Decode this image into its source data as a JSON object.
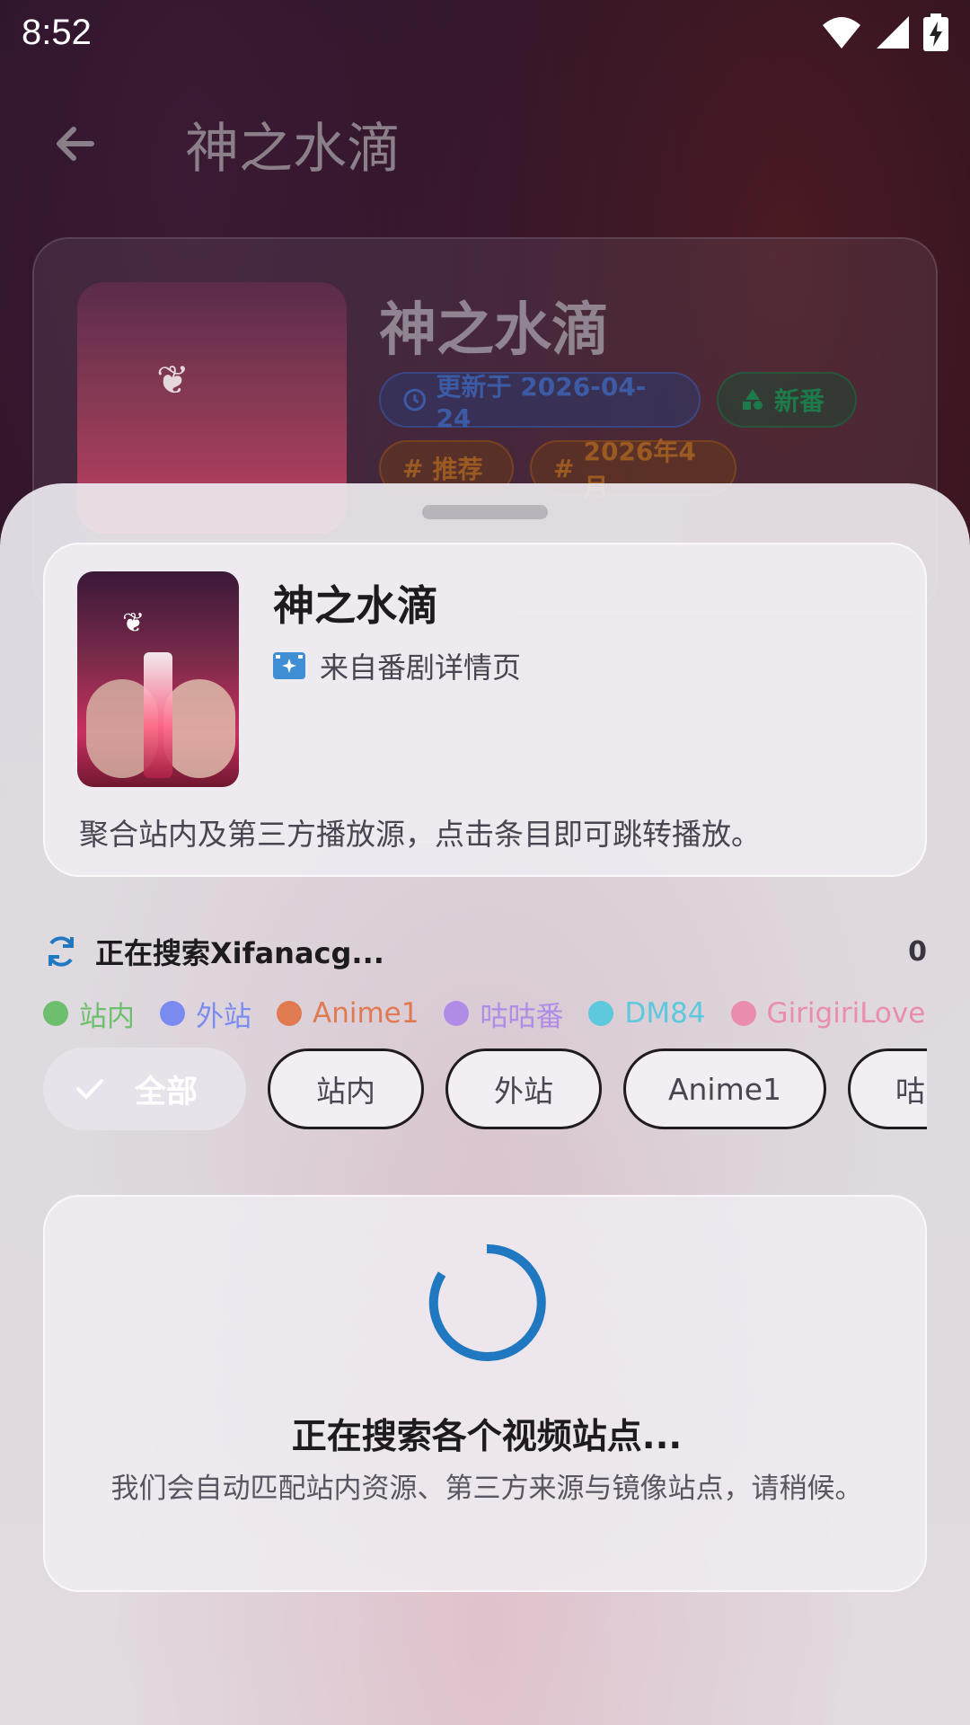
{
  "status_bar": {
    "time": "8:52",
    "icons": [
      "wifi-icon",
      "signal-icon",
      "battery-charging-icon"
    ]
  },
  "appbar": {
    "title": "神之水滴",
    "back_icon": "arrow-left-icon"
  },
  "background_card": {
    "title": "神之水滴",
    "updated_chip": "更新于 2026-04-24",
    "new_chip": "新番",
    "tag1": "推荐",
    "tag2": "2026年4月"
  },
  "sheet": {
    "title": "神之水滴",
    "source": "来自番剧详情页",
    "description": "聚合站内及第三方播放源，点击条目即可跳转播放。",
    "search_status": "正在搜索Xifanacg...",
    "result_count": "0",
    "legend": [
      {
        "label": "站内",
        "color": "#6dbf6d"
      },
      {
        "label": "外站",
        "color": "#7a8cf0"
      },
      {
        "label": "Anime1",
        "color": "#e07a50"
      },
      {
        "label": "咕咕番",
        "color": "#b08ce6"
      },
      {
        "label": "DM84",
        "color": "#5ec8dc"
      },
      {
        "label": "GirigiriLove",
        "color": "#e98cb0"
      }
    ],
    "filters": {
      "all": "全部",
      "chips": [
        "站内",
        "外站",
        "Anime1",
        "咕咕番"
      ]
    },
    "loading_title": "正在搜索各个视频站点...",
    "loading_desc": "我们会自动匹配站内资源、第三方来源与镜像站点，请稍候。"
  },
  "colors": {
    "accent": "#1f78c0",
    "primary_text": "#1e1b1f"
  }
}
